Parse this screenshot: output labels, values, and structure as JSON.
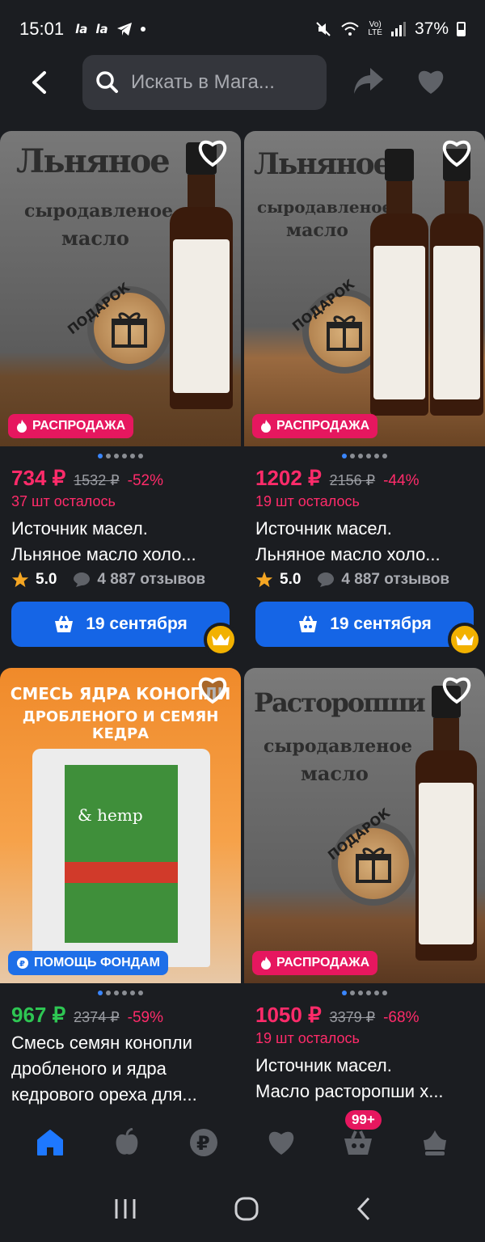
{
  "status_bar": {
    "time": "15:01",
    "battery": "37%",
    "icons": [
      "vk-icon",
      "vk-icon",
      "telegram-icon",
      "dot"
    ]
  },
  "search": {
    "placeholder": "Искать в Мага..."
  },
  "products": [
    {
      "badge": "РАСПРОДАЖА",
      "badge_type": "sale",
      "image_text": {
        "line1": "Льняное",
        "line2": "сыродавленое",
        "line3": "масло",
        "gift": "ПОДАРОК"
      },
      "price": "734 ₽",
      "old_price": "1532 ₽",
      "discount": "-52%",
      "stock": "37 шт осталось",
      "title_line1": "Источник масел.",
      "title_line2": "Льняное масло холо...",
      "rating": "5.0",
      "reviews": "4 887 отзывов",
      "delivery": "19 сентября",
      "dots_active": 1
    },
    {
      "badge": "РАСПРОДАЖА",
      "badge_type": "sale",
      "image_text": {
        "line1": "Льняное",
        "line2": "сыродавленое",
        "line3": "масло",
        "gift": "ПОДАРОК"
      },
      "price": "1202 ₽",
      "old_price": "2156 ₽",
      "discount": "-44%",
      "stock": "19 шт осталось",
      "title_line1": "Источник масел.",
      "title_line2": "Льняное масло холо...",
      "rating": "5.0",
      "reviews": "4 887 отзывов",
      "delivery": "19 сентября",
      "dots_active": 1
    },
    {
      "badge": "ПОМОЩЬ ФОНДАМ",
      "badge_type": "charity",
      "image_text": {
        "line1": "СМЕСЬ ЯДРА КОНОПЛИ",
        "line2": "ДРОБЛЕНОГО И СЕМЯН КЕДРА",
        "line3": "",
        "gift": ""
      },
      "price": "967 ₽",
      "price_color": "green",
      "old_price": "2374 ₽",
      "discount": "-59%",
      "stock": "",
      "title_line1": "Смесь семян конопли",
      "title_line2": "дробленого и ядра",
      "title_line3": "кедрового ореха для...",
      "dots_active": 1
    },
    {
      "badge": "РАСПРОДАЖА",
      "badge_type": "sale",
      "image_text": {
        "line1": "Расторопши",
        "line2": "сыродавленое",
        "line3": "масло",
        "gift": "ПОДАРОК"
      },
      "price": "1050 ₽",
      "old_price": "3379 ₽",
      "discount": "-68%",
      "stock": "19 шт осталось",
      "title_line1": "Источник масел.",
      "title_line2": "Масло расторопши х...",
      "dots_active": 1
    }
  ],
  "bottom_nav": {
    "items": [
      "home-icon",
      "catalog-icon",
      "payments-icon",
      "favorites-icon",
      "cart-icon",
      "profile-icon"
    ],
    "cart_badge": "99+"
  },
  "colors": {
    "accent": "#1565e6",
    "sale": "#ff2b6a",
    "green": "#2ec653",
    "bg": "#1b1d21"
  }
}
